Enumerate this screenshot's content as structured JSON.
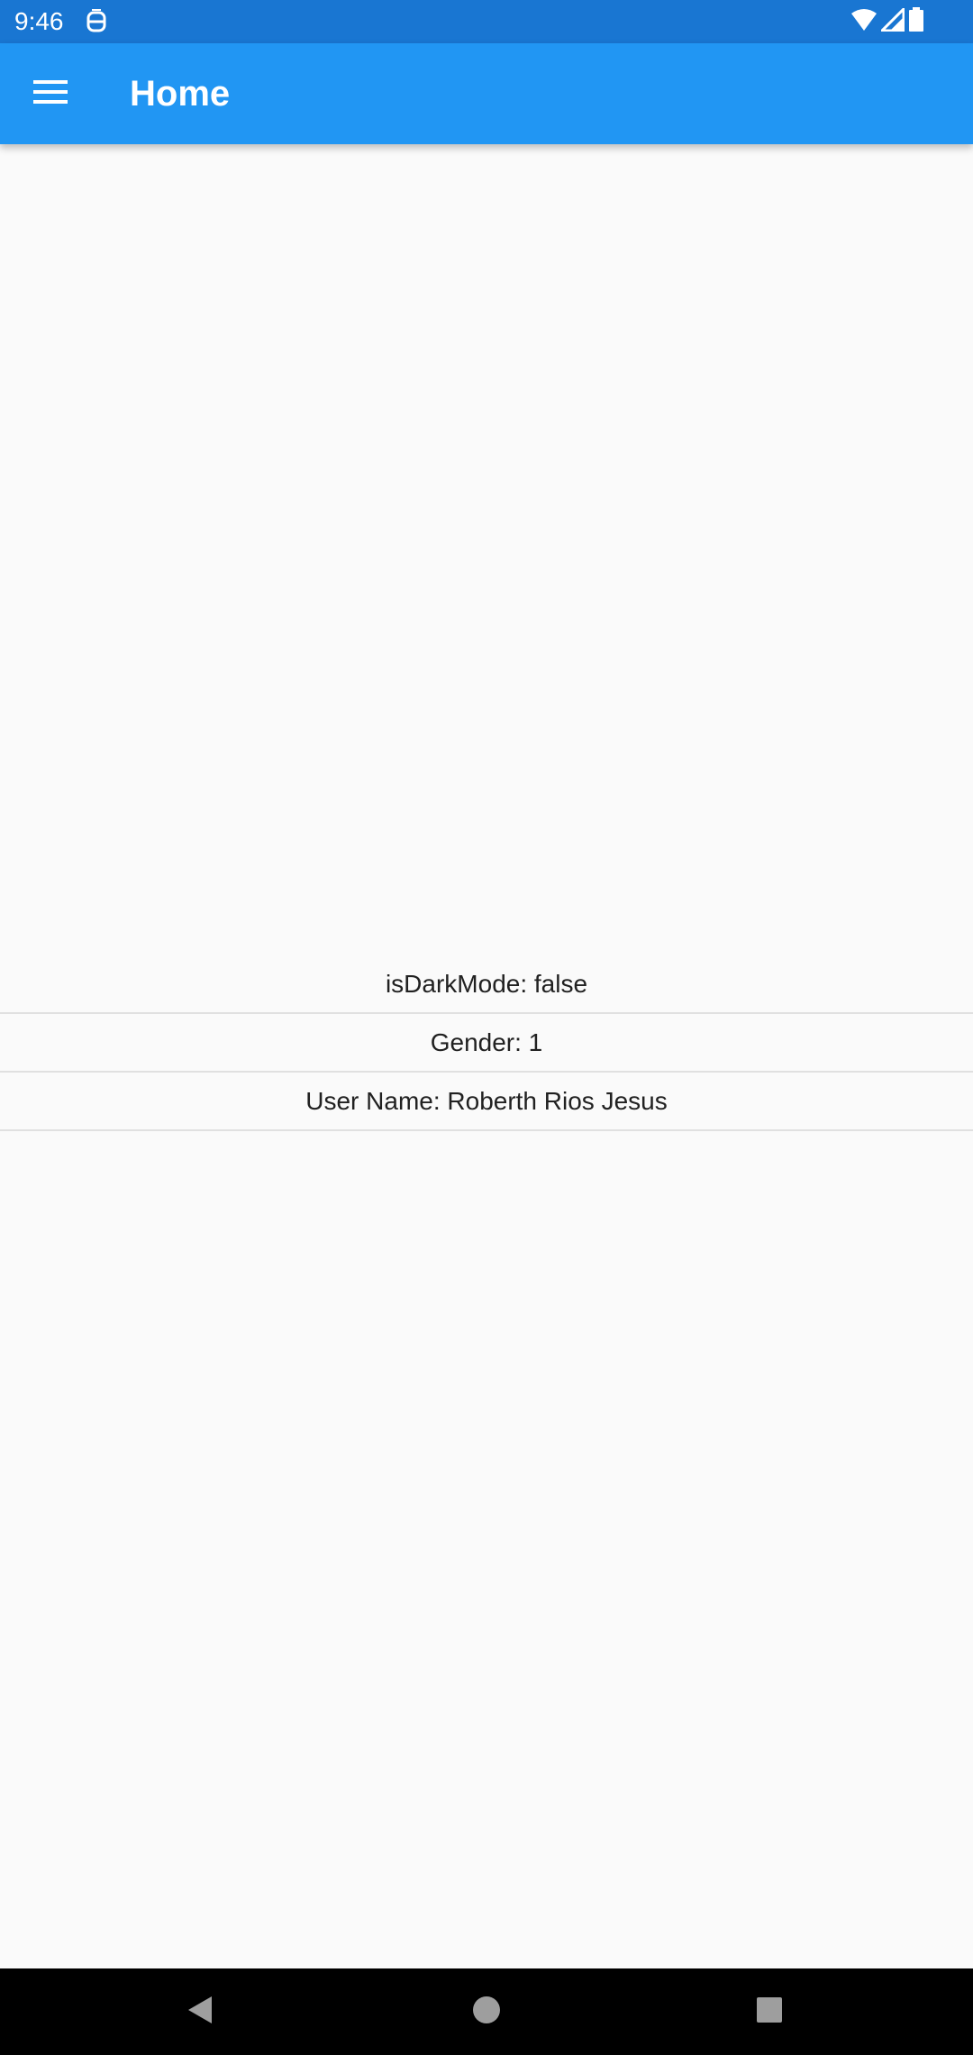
{
  "status_bar": {
    "time": "9:46",
    "background": "#1976D2",
    "icons": [
      "notification-s-icon",
      "wifi-icon",
      "signal-icon",
      "battery-icon"
    ]
  },
  "app_bar": {
    "title": "Home",
    "background": "#2196F3",
    "menu_icon": "hamburger-menu-icon"
  },
  "content": {
    "items": [
      {
        "label": "isDarkMode: false"
      },
      {
        "label": "Gender: 1"
      },
      {
        "label": "User Name: Roberth Rios Jesus"
      }
    ]
  },
  "nav_bar": {
    "buttons": [
      "back-icon",
      "home-icon",
      "recents-icon"
    ]
  }
}
